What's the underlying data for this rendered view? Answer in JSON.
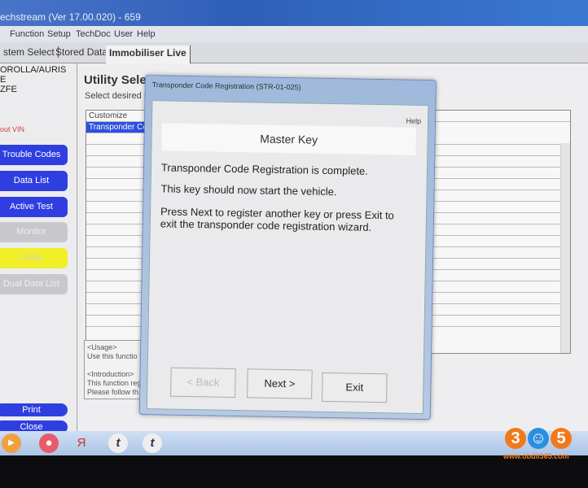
{
  "window": {
    "title": "echstream (Ver 17.00.020) - 659"
  },
  "menu": [
    "Function",
    "Setup",
    "TechDoc",
    "User",
    "Help"
  ],
  "tabs": [
    "stem Select",
    "Stored Data",
    "Immobiliser Live"
  ],
  "vehicle": {
    "line1": "OROLLA/AURIS",
    "line2": "E",
    "line3": "ZFE",
    "vin_label": "out VIN"
  },
  "left_buttons": {
    "trouble_codes": "Trouble Codes",
    "data_list": "Data List",
    "active_test": "Active Test",
    "monitor": "Monitor",
    "utility": "Utility",
    "dual_data_list": "Dual Data List",
    "print": "Print",
    "close": "Close"
  },
  "main": {
    "title": "Utility Selec",
    "subtitle": "Select desired U",
    "list": [
      "Customize",
      "Transponder Co"
    ],
    "usage": [
      "<Usage>",
      "Use this functio",
      "",
      "<Introduction>",
      "This function reg",
      "Please follow th"
    ]
  },
  "dialog": {
    "title": "Transponder Code Registration (STR-01-025)",
    "help": "Help",
    "header": "Master Key",
    "line1": "Transponder Code Registration is complete.",
    "line2": "This key should now start the vehicle.",
    "line3": "Press Next to register another key or press Exit to exit the transponder code registration wizard.",
    "back": "< Back",
    "next": "Next >",
    "exit": "Exit"
  },
  "watermark": {
    "text": "365",
    "url": "www.obdii365.com"
  },
  "colors": {
    "button_blue": "#2f3ee0",
    "utility_yellow": "#f0ef2a",
    "selection": "#2e4fe0"
  }
}
